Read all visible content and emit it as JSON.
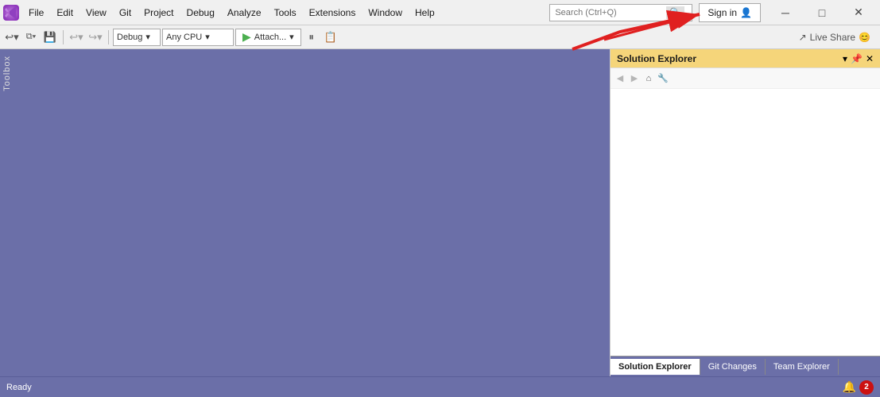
{
  "titlebar": {
    "logo": "VS",
    "menus": [
      "File",
      "Edit",
      "View",
      "Git",
      "Project",
      "Debug",
      "Analyze",
      "Tools",
      "Extensions",
      "Window",
      "Help"
    ],
    "search_placeholder": "Search (Ctrl+Q)",
    "sign_in_label": "Sign in"
  },
  "toolbar": {
    "debug_label": "Debug",
    "cpu_label": "Any CPU",
    "attach_label": "Attach...",
    "live_share_label": "Live Share"
  },
  "toolbox": {
    "label": "Toolbox"
  },
  "solution_explorer": {
    "title": "Solution Explorer",
    "tabs": [
      {
        "label": "Solution Explorer",
        "active": true
      },
      {
        "label": "Git Changes",
        "active": false
      },
      {
        "label": "Team Explorer",
        "active": false
      }
    ]
  },
  "statusbar": {
    "status_text": "Ready",
    "notification_count": "2"
  },
  "icons": {
    "minimize": "─",
    "restore": "□",
    "close": "✕",
    "search": "🔍",
    "back": "◀",
    "forward": "▶",
    "dropdown_arrow": "▾",
    "play": "▶",
    "settings": "⚙",
    "home": "⌂",
    "wrench": "🔧",
    "pin": "📌",
    "notification": "🔔"
  }
}
